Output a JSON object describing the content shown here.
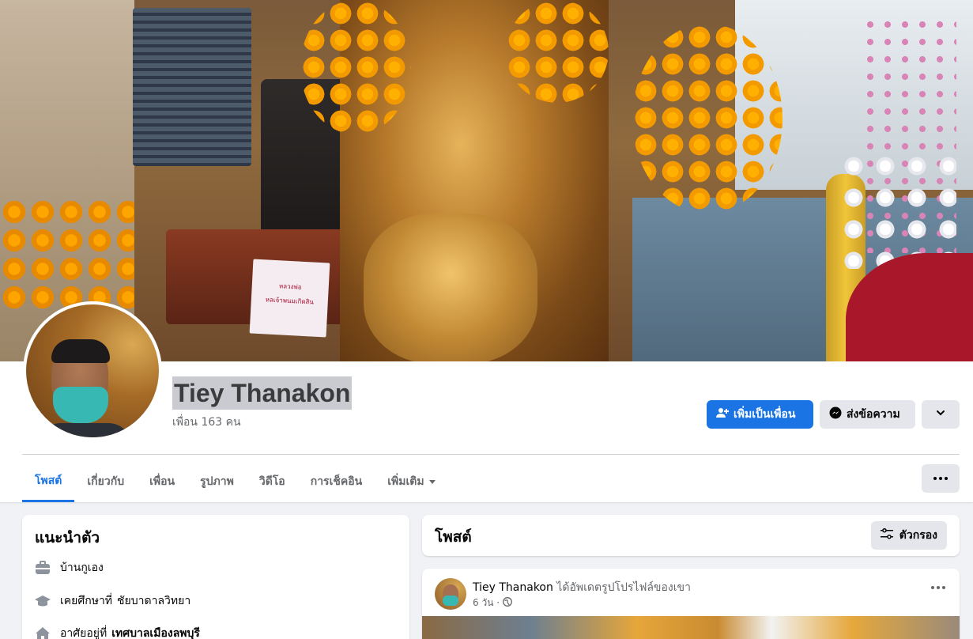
{
  "cover": {
    "sign_line1": "หลวงพ่อ",
    "sign_line2": "หลเจ้าพนมเกิดสิน"
  },
  "profile": {
    "name": "Tiey Thanakon",
    "friends": "เพื่อน 163 คน"
  },
  "actions": {
    "add_friend": "เพิ่มเป็นเพื่อน",
    "message": "ส่งข้อความ"
  },
  "tabs": [
    {
      "label": "โพสต์"
    },
    {
      "label": "เกี่ยวกับ"
    },
    {
      "label": "เพื่อน"
    },
    {
      "label": "รูปภาพ"
    },
    {
      "label": "วิดีโอ"
    },
    {
      "label": "การเช็คอิน"
    },
    {
      "label": "เพิ่มเติม"
    }
  ],
  "intro": {
    "title": "แนะนำตัว",
    "hometown": "บ้านกูเอง",
    "education_prefix": "เคยศึกษาที่",
    "education_place": "ชัยบาดาลวิทยา",
    "lives_prefix": "อาศัยอยู่ที่",
    "lives_place": "เทศบาลเมืองลพบุรี"
  },
  "posts": {
    "title": "โพสต์",
    "filter": "ตัวกรอง"
  },
  "post": {
    "author": "Tiey Thanakon",
    "action": "ได้อัพเดตรูปโปรไฟล์ของเขา",
    "time": "6 วัน ·"
  },
  "colors": {
    "accent": "#1b74e4",
    "button_gray": "#e4e6eb",
    "background": "#f0f2f5"
  }
}
